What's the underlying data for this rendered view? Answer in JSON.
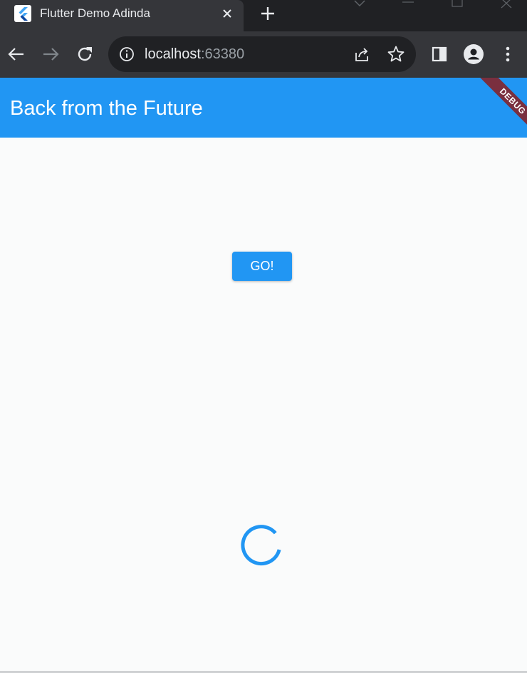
{
  "browser": {
    "tab": {
      "title": "Flutter Demo Adinda",
      "favicon": "flutter-logo-icon",
      "close_icon": "close-icon"
    },
    "new_tab_icon": "plus-icon",
    "window_controls": [
      "chevron-down-icon",
      "minimize-icon",
      "maximize-icon",
      "close-icon"
    ],
    "nav": {
      "back_icon": "arrow-left-icon",
      "forward_icon": "arrow-right-icon",
      "reload_icon": "reload-icon"
    },
    "omnibox": {
      "info_icon": "info-icon",
      "host": "localhost",
      "port": ":63380",
      "share_icon": "share-icon",
      "bookmark_icon": "star-icon"
    },
    "side_panel_icon": "side-panel-icon",
    "profile_icon": "profile-icon",
    "menu_icon": "kebab-menu-icon"
  },
  "app": {
    "title": "Back from the Future",
    "debug_banner": "DEBUG",
    "go_button": "GO!",
    "spinner_icon": "circular-progress-icon"
  },
  "colors": {
    "primary": "#2196f3",
    "debug_banner": "#7a2f3f",
    "background": "#fafbfb",
    "chrome_dark": "#202124",
    "chrome_toolbar": "#35363a"
  }
}
